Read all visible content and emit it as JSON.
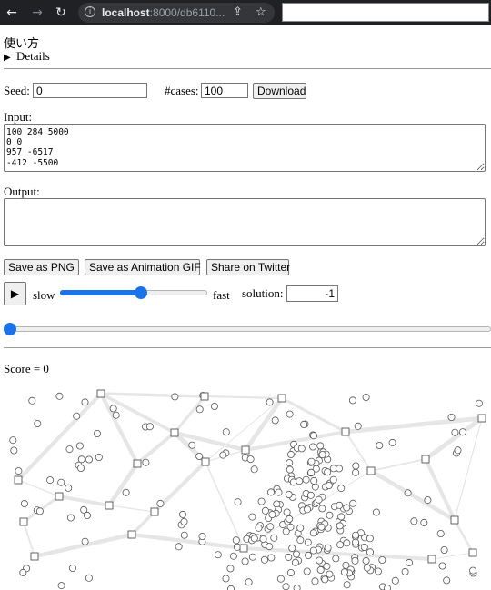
{
  "browser": {
    "url_host": "localhost",
    "url_rest": ":8000/db6110..."
  },
  "page": {
    "usage_heading": "使い方",
    "details_label": "Details",
    "seed_label": "Seed:",
    "seed_value": "0",
    "cases_label": "#cases:",
    "cases_value": "100",
    "download_label": "Download",
    "input_label": "Input:",
    "input_text": "100 284 5000\n0 0\n957 -6517\n-412 -5500",
    "output_label": "Output:",
    "output_text": "",
    "save_png_label": "Save as PNG",
    "save_gif_label": "Save as Animation GIF",
    "share_twitter_label": "Share on Twitter",
    "play_symbol": "▶",
    "slow_label": "slow",
    "fast_label": "fast",
    "speed_value": 0.55,
    "solution_label": "solution:",
    "solution_value": "-1",
    "turn_value": 0,
    "score_text": "Score = 0"
  },
  "visual": {
    "accent_color": "#1a73e8",
    "node_stroke": "#555555",
    "edge_color": "#e6e6e6",
    "station_count": 22,
    "residence_count": 280
  }
}
